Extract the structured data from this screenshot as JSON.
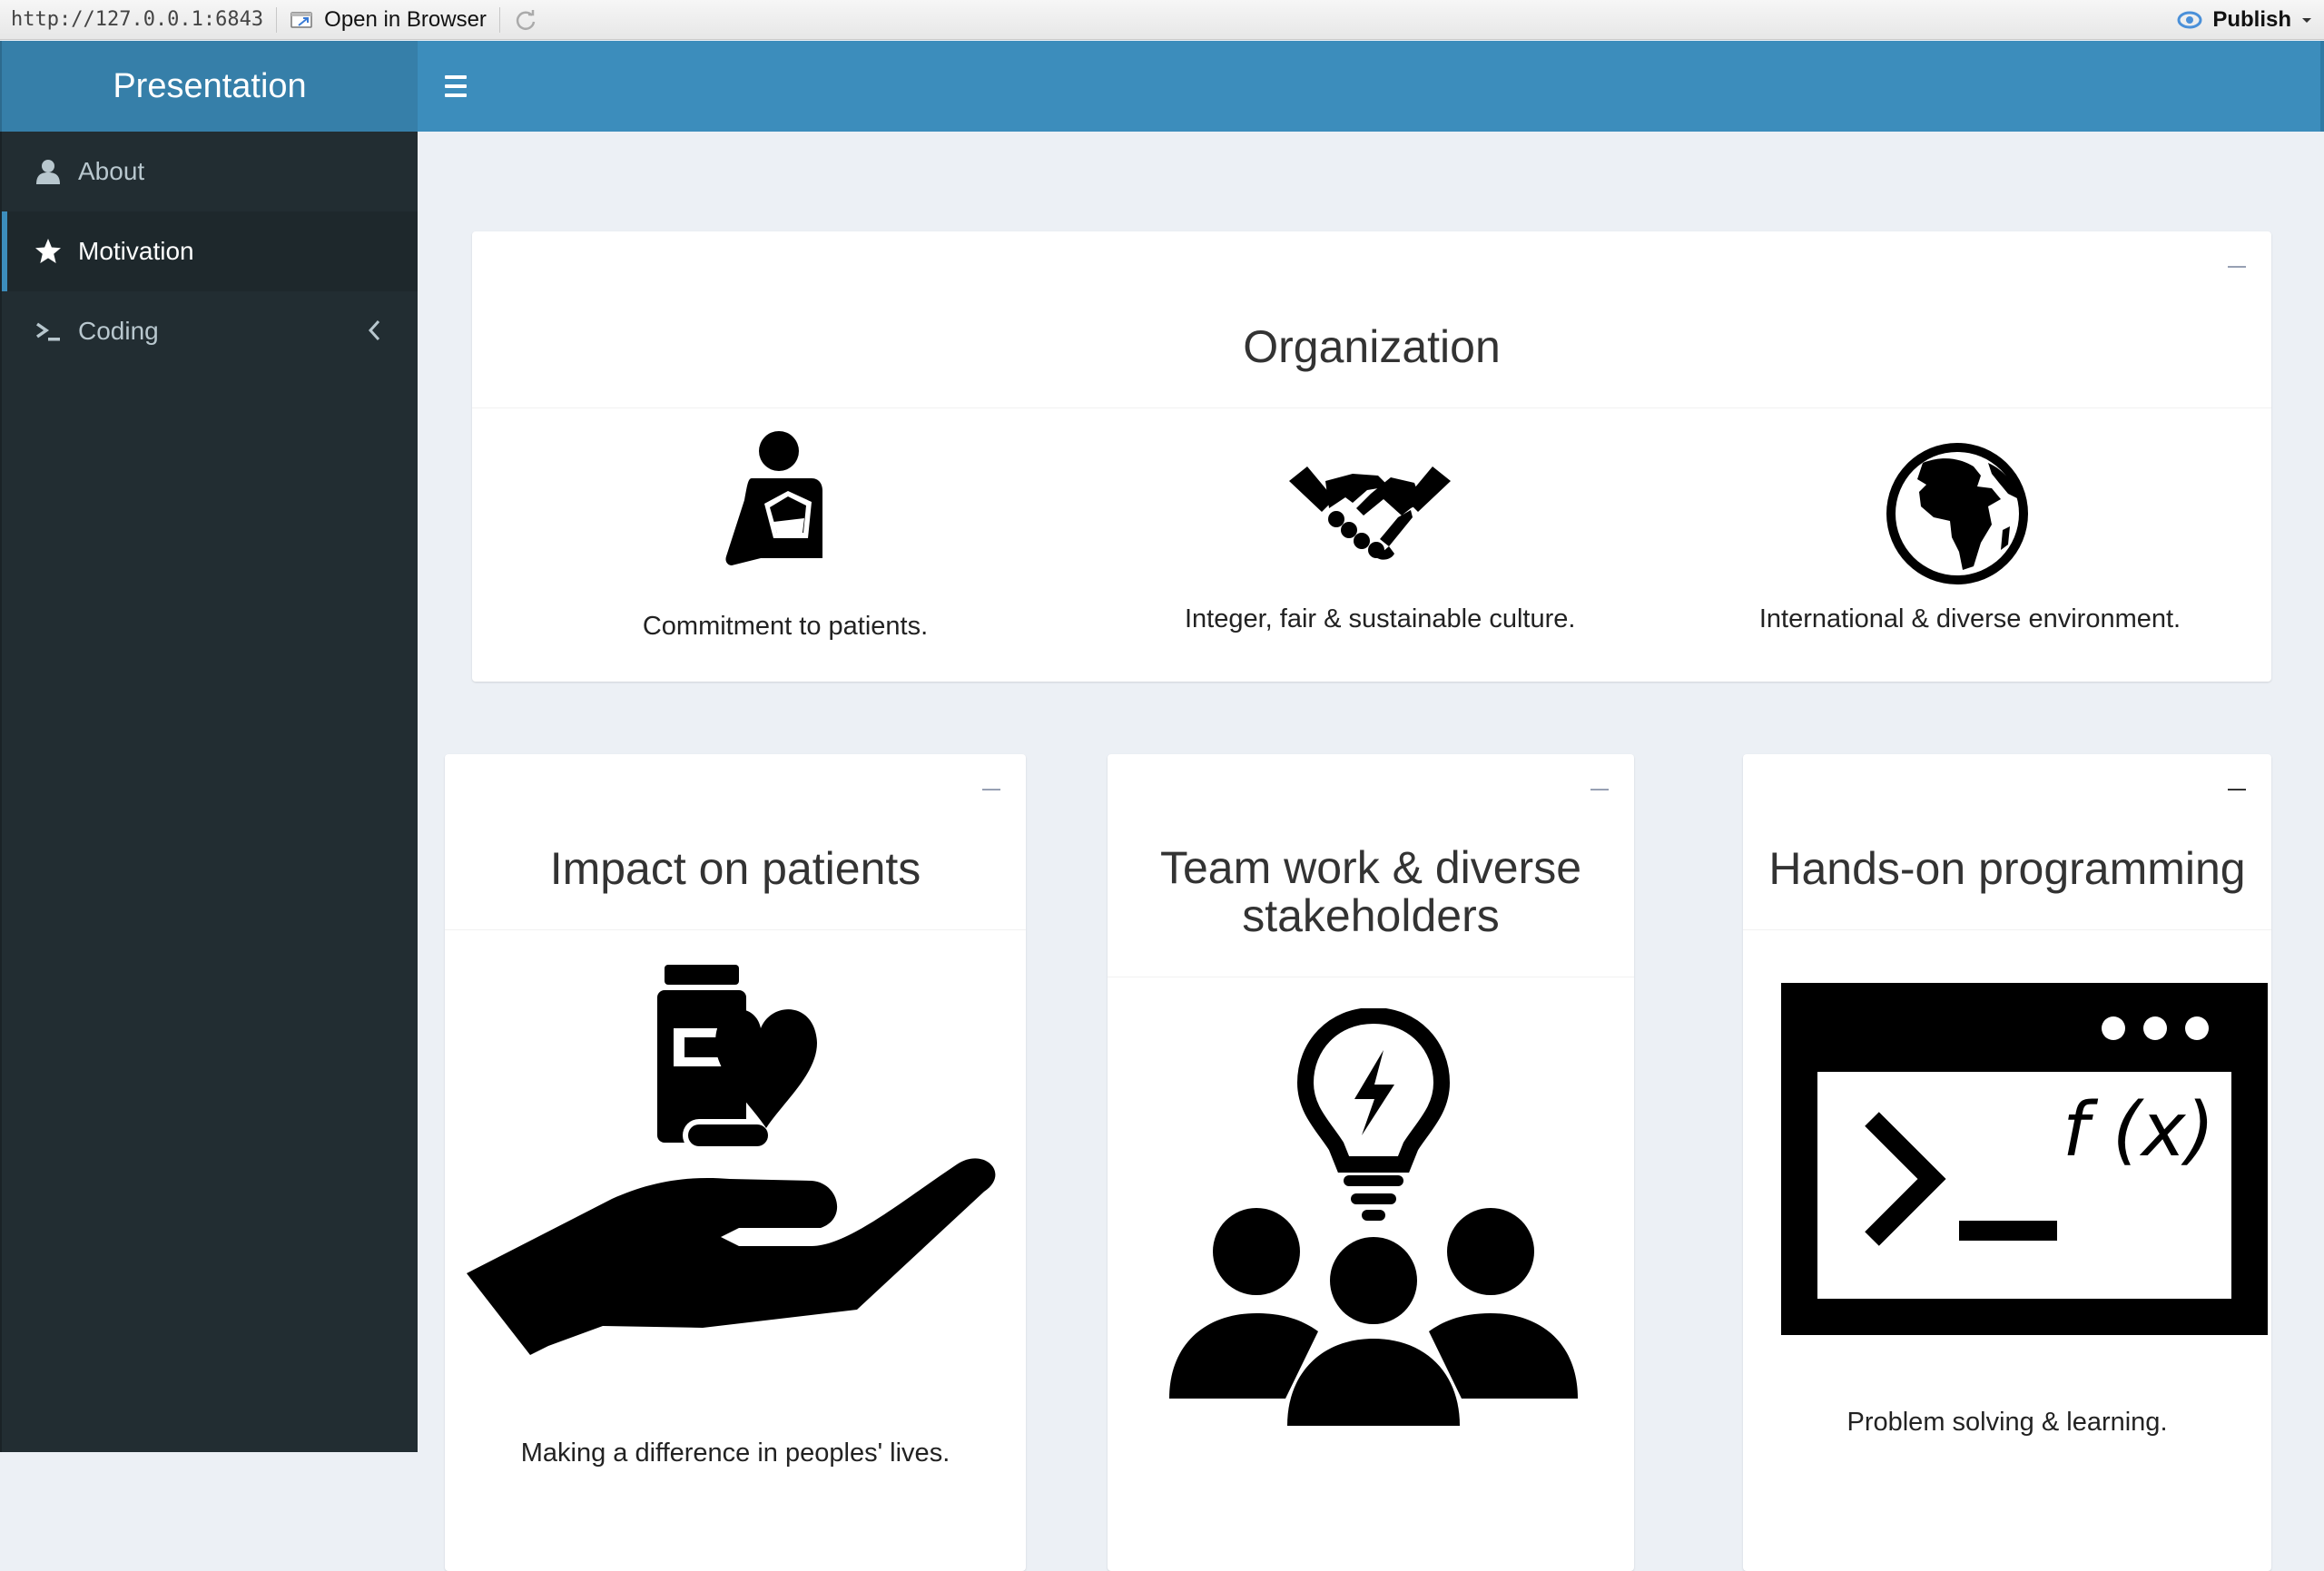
{
  "viewer": {
    "url": "http://127.0.0.1:6843",
    "open_in_browser": "Open in Browser",
    "publish": "Publish"
  },
  "app": {
    "title": "Presentation"
  },
  "sidebar": {
    "items": [
      {
        "label": "About",
        "icon": "user-icon",
        "active": false
      },
      {
        "label": "Motivation",
        "icon": "star-icon",
        "active": true
      },
      {
        "label": "Coding",
        "icon": "terminal-icon",
        "active": false,
        "expandable": true
      }
    ]
  },
  "organization": {
    "title": "Organization",
    "items": [
      {
        "icon": "injured-person-icon",
        "caption": "Commitment to patients."
      },
      {
        "icon": "handshake-icon",
        "caption": "Integer, fair & sustainable culture."
      },
      {
        "icon": "globe-africa-icon",
        "caption": "International & diverse environment."
      }
    ]
  },
  "cards": [
    {
      "title": "Impact on patients",
      "icon": "hand-medicine-heart-icon",
      "caption": "Making a difference in peoples' lives."
    },
    {
      "title_line1": "Team work & diverse",
      "title_line2": "stakeholders",
      "icon": "team-idea-icon",
      "caption": ""
    },
    {
      "title": "Hands-on programming",
      "icon": "terminal-function-icon",
      "caption": "Problem solving & learning."
    }
  ],
  "colors": {
    "navbar": "#3c8dbc",
    "logo": "#367fa9",
    "sidebar": "#222d32",
    "content_bg": "#ecf0f5"
  }
}
